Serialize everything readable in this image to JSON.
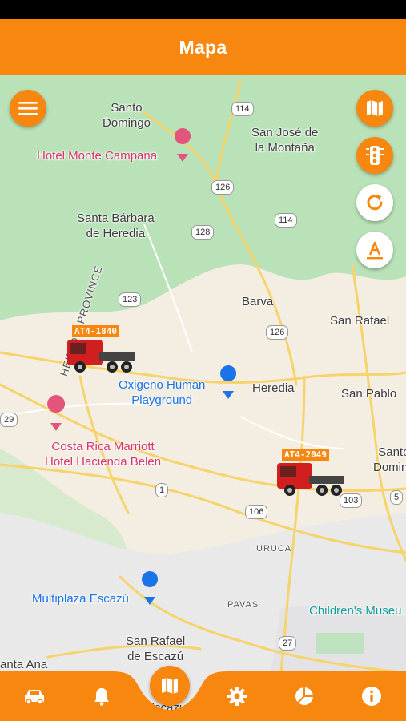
{
  "header": {
    "title": "Mapa"
  },
  "map": {
    "places": {
      "santo_domingo_top": "Santo\nDomingo",
      "san_jose_montana": "San José de\nla Montaña",
      "hotel_monte_campana": "Hotel Monte Campana",
      "santa_barbara": "Santa Bárbara\nde Heredia",
      "herdia_province": "HEREDIA PROVINCE",
      "barva": "Barva",
      "san_rafael": "San Rafael",
      "oxigeno": "Oxigeno Human\nPlayground",
      "heredia": "Heredia",
      "san_pablo": "San Pablo",
      "marriott": "Costa Rica Marriott\nHotel Hacienda Belen",
      "santo_domingo_right": "Santo\nDoming",
      "uruca": "URUCA",
      "multiplaza": "Multiplaza Escazú",
      "pavas": "PAVAS",
      "childrens": "Children's Museu",
      "san_rafael_escazu": "San Rafael\nde Escazú",
      "santa_ana": "anta Ana",
      "escazu": "Escazu"
    },
    "shields": [
      "114",
      "126",
      "128",
      "114",
      "123",
      "126",
      "29",
      "1",
      "106",
      "103",
      "5",
      "27"
    ],
    "vehicles": [
      {
        "id": "AT4-1840"
      },
      {
        "id": "AT4-2049"
      }
    ],
    "colors": {
      "accent": "#f7870f",
      "road": "#f6d36b",
      "green": "#b9e2b8"
    }
  },
  "fabs": {
    "menu": "menu-icon",
    "map_layers": "map-icon",
    "traffic": "traffic-light-icon",
    "refresh": "refresh-icon",
    "labels": "label-icon"
  },
  "nav": {
    "items": [
      "car-icon",
      "bell-icon",
      "map-icon",
      "gear-icon",
      "pie-chart-icon",
      "info-icon"
    ],
    "active": "map-icon"
  }
}
